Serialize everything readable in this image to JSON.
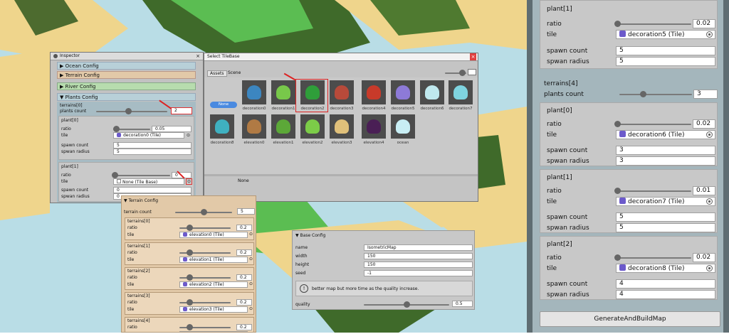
{
  "inspector": {
    "title": "Inspector",
    "sections": [
      "Ocean Config",
      "Terrain Config",
      "River Config",
      "Plants Config"
    ],
    "terrains0": "terrains[0]",
    "plants_count_label": "plants count",
    "plants_count": "2",
    "plant0": {
      "header": "plant[0]",
      "ratio_label": "ratio",
      "ratio": "0.05",
      "tile_label": "tile",
      "tile": "decoration0 (Tile)",
      "spawn_label": "spawn count",
      "spawn": "5",
      "radius_label": "spwan radius",
      "radius": "5"
    },
    "plant1": {
      "header": "plant[1]",
      "ratio_label": "ratio",
      "ratio": "0",
      "tile_label": "tile",
      "tile": "None (Tile Base)",
      "spawn_label": "spawn count",
      "spawn": "0",
      "radius_label": "spwan radius",
      "radius": "0"
    }
  },
  "selector": {
    "title": "Select TileBase",
    "tabs": [
      "Assets",
      "Scene"
    ],
    "none_button": "None",
    "selected_label": "None",
    "tiles": [
      {
        "name": "decoration0",
        "color": "#3c86c0"
      },
      {
        "name": "decoration1",
        "color": "#78c84a"
      },
      {
        "name": "decoration2",
        "color": "#2f9e3a"
      },
      {
        "name": "decoration3",
        "color": "#b84a3a"
      },
      {
        "name": "decoration4",
        "color": "#c83a2a"
      },
      {
        "name": "decoration5",
        "color": "#8d7ad8"
      },
      {
        "name": "decoration6",
        "color": "#bfe8ee"
      },
      {
        "name": "decoration7",
        "color": "#7fd4e0"
      },
      {
        "name": "decoration8",
        "color": "#3fb0c0"
      },
      {
        "name": "elevation0",
        "color": "#b07a44"
      },
      {
        "name": "elevation1",
        "color": "#5ca838"
      },
      {
        "name": "elevation2",
        "color": "#7ccc48"
      },
      {
        "name": "elevation3",
        "color": "#e0c07a"
      },
      {
        "name": "elevation4",
        "color": "#4a1f55"
      },
      {
        "name": "ocean",
        "color": "#c8eef4"
      }
    ]
  },
  "terrain": {
    "title": "Terrain Config",
    "count_label": "terrain count",
    "count": "5",
    "items": [
      {
        "header": "terrains[0]",
        "ratio_label": "ratio",
        "ratio": "0.2",
        "tile_label": "tile",
        "tile": "elevation0 (Tile)"
      },
      {
        "header": "terrains[1]",
        "ratio_label": "ratio",
        "ratio": "0.2",
        "tile_label": "tile",
        "tile": "elevation1 (Tile)"
      },
      {
        "header": "terrains[2]",
        "ratio_label": "ratio",
        "ratio": "0.2",
        "tile_label": "tile",
        "tile": "elevation2 (Tile)"
      },
      {
        "header": "terrains[3]",
        "ratio_label": "ratio",
        "ratio": "0.2",
        "tile_label": "tile",
        "tile": "elevation3 (Tile)"
      },
      {
        "header": "terrains[4]",
        "ratio_label": "ratio",
        "ratio": "0.2",
        "tile_label": "tile",
        "tile": "elevation4 (Tile)"
      }
    ]
  },
  "base": {
    "title": "Base Config",
    "name_label": "name",
    "name": "IsometricMap",
    "width_label": "width",
    "width": "150",
    "height_label": "height",
    "height": "150",
    "seed_label": "seed",
    "seed": "-1",
    "note": "better map but more time as the quality increase.",
    "quality_label": "quality",
    "quality": "0.5"
  },
  "right": {
    "top_plant": {
      "header": "plant[1]",
      "ratio_label": "ratio",
      "ratio": "0.02",
      "tile_label": "tile",
      "tile": "decoration5 (Tile)",
      "spawn_label": "spawn count",
      "spawn": "5",
      "radius_label": "spwan radius",
      "radius": "5"
    },
    "terrains4": "terrains[4]",
    "plants_count_label": "plants count",
    "plants_count": "3",
    "plants": [
      {
        "header": "plant[0]",
        "ratio_label": "ratio",
        "ratio": "0.02",
        "tile_label": "tile",
        "tile": "decoration6 (Tile)",
        "spawn_label": "spawn count",
        "spawn": "3",
        "radius_label": "spwan radius",
        "radius": "3"
      },
      {
        "header": "plant[1]",
        "ratio_label": "ratio",
        "ratio": "0.01",
        "tile_label": "tile",
        "tile": "decoration7 (Tile)",
        "spawn_label": "spawn count",
        "spawn": "5",
        "radius_label": "spwan radius",
        "radius": "5"
      },
      {
        "header": "plant[2]",
        "ratio_label": "ratio",
        "ratio": "0.02",
        "tile_label": "tile",
        "tile": "decoration8 (Tile)",
        "spawn_label": "spawn count",
        "spawn": "4",
        "radius_label": "spwan radius",
        "radius": "4"
      }
    ],
    "generate_button": "GenerateAndBuildMap"
  }
}
